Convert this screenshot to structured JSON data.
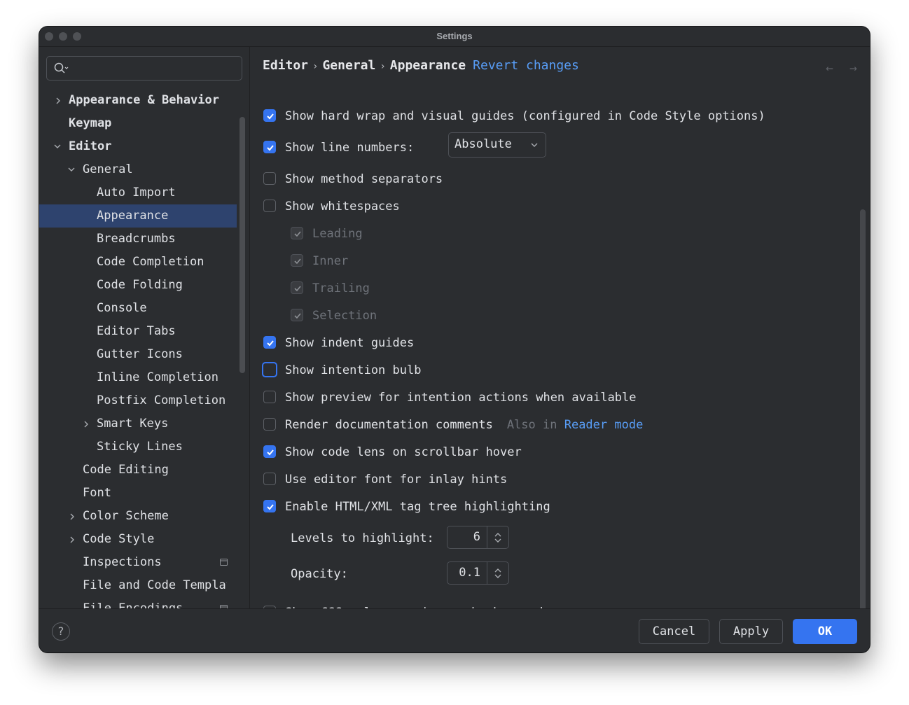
{
  "window": {
    "title": "Settings"
  },
  "search": {
    "placeholder": ""
  },
  "sidebar": {
    "items": [
      {
        "label": "Appearance & Behavior"
      },
      {
        "label": "Keymap"
      },
      {
        "label": "Editor"
      },
      {
        "label": "General"
      },
      {
        "label": "Auto Import"
      },
      {
        "label": "Appearance"
      },
      {
        "label": "Breadcrumbs"
      },
      {
        "label": "Code Completion"
      },
      {
        "label": "Code Folding"
      },
      {
        "label": "Console"
      },
      {
        "label": "Editor Tabs"
      },
      {
        "label": "Gutter Icons"
      },
      {
        "label": "Inline Completion"
      },
      {
        "label": "Postfix Completion"
      },
      {
        "label": "Smart Keys"
      },
      {
        "label": "Sticky Lines"
      },
      {
        "label": "Code Editing"
      },
      {
        "label": "Font"
      },
      {
        "label": "Color Scheme"
      },
      {
        "label": "Code Style"
      },
      {
        "label": "Inspections"
      },
      {
        "label": "File and Code Templates"
      },
      {
        "label": "File Encodings"
      }
    ]
  },
  "breadcrumb": {
    "items": [
      "Editor",
      "General",
      "Appearance"
    ],
    "revert": "Revert changes"
  },
  "options": {
    "hard_wrap": "Show hard wrap and visual guides (configured in Code Style options)",
    "line_numbers": "Show line numbers:",
    "line_numbers_mode": "Absolute",
    "method_separators": "Show method separators",
    "whitespaces": "Show whitespaces",
    "leading": "Leading",
    "inner": "Inner",
    "trailing": "Trailing",
    "selection": "Selection",
    "indent_guides": "Show indent guides",
    "intention_bulb": "Show intention bulb",
    "preview_intention": "Show preview for intention actions when available",
    "render_docs": "Render documentation comments",
    "render_docs_hint": "Also in",
    "render_docs_link": "Reader mode",
    "code_lens": "Show code lens on scrollbar hover",
    "editor_font_inlay": "Use editor font for inlay hints",
    "tag_tree": "Enable HTML/XML tag tree highlighting",
    "levels_label": "Levels to highlight:",
    "levels_value": "6",
    "opacity_label": "Opacity:",
    "opacity_value": "0.1",
    "css_color": "Show CSS color preview as background"
  },
  "footer": {
    "help": "?",
    "cancel": "Cancel",
    "apply": "Apply",
    "ok": "OK"
  },
  "colors": {
    "accent": "#3574f0",
    "link": "#589df6",
    "selection": "#2e436e",
    "background": "#2b2d30"
  }
}
